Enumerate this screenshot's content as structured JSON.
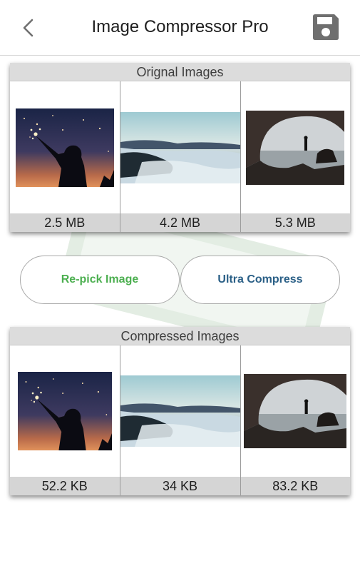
{
  "app_bar": {
    "title": "Image Compressor Pro",
    "back_icon": "chevron-left-icon",
    "save_icon": "floppy-disk-icon"
  },
  "original_panel": {
    "title": "Orignal Images",
    "items": [
      {
        "size": "2.5 MB",
        "scene": "sparkler-silhouette"
      },
      {
        "size": "4.2 MB",
        "scene": "sea-of-clouds"
      },
      {
        "size": "5.3 MB",
        "scene": "sea-cave"
      }
    ]
  },
  "buttons": {
    "repick_label": "Re-pick Image",
    "ultra_label": "Ultra Compress"
  },
  "compressed_panel": {
    "title": "Compressed Images",
    "items": [
      {
        "size": "52.2 KB",
        "scene": "sparkler-silhouette"
      },
      {
        "size": "34 KB",
        "scene": "sea-of-clouds"
      },
      {
        "size": "83.2 KB",
        "scene": "sea-cave"
      }
    ]
  },
  "colors": {
    "repick_text": "#4caf50",
    "ultra_text": "#2a5f86",
    "header_bg": "#dcdcdc",
    "size_bar_bg": "#d5d5d5"
  }
}
